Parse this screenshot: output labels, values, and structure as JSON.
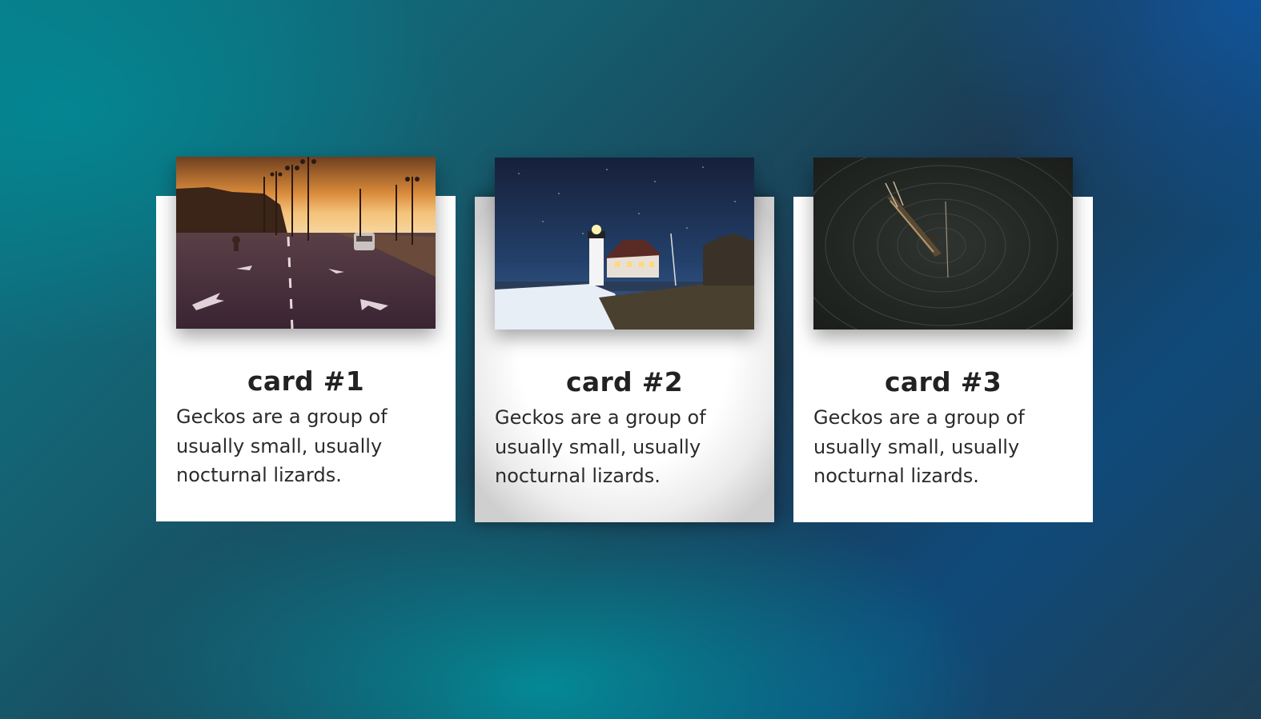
{
  "cards": [
    {
      "title": "card #1",
      "text": "Geckos are a group of usually small, usually nocturnal lizards.",
      "image_icon": "sunset-road-photo"
    },
    {
      "title": "card #2",
      "text": "Geckos are a group of usually small, usually nocturnal lizards.",
      "image_icon": "lighthouse-night-photo"
    },
    {
      "title": "card #3",
      "text": "Geckos are a group of usually small, usually nocturnal lizards.",
      "image_icon": "boat-on-water-photo"
    }
  ],
  "colors": {
    "background_teal": "#0b7a88",
    "background_blue": "#0f4a7a",
    "card_background": "#ffffff",
    "title_color": "#222222"
  }
}
